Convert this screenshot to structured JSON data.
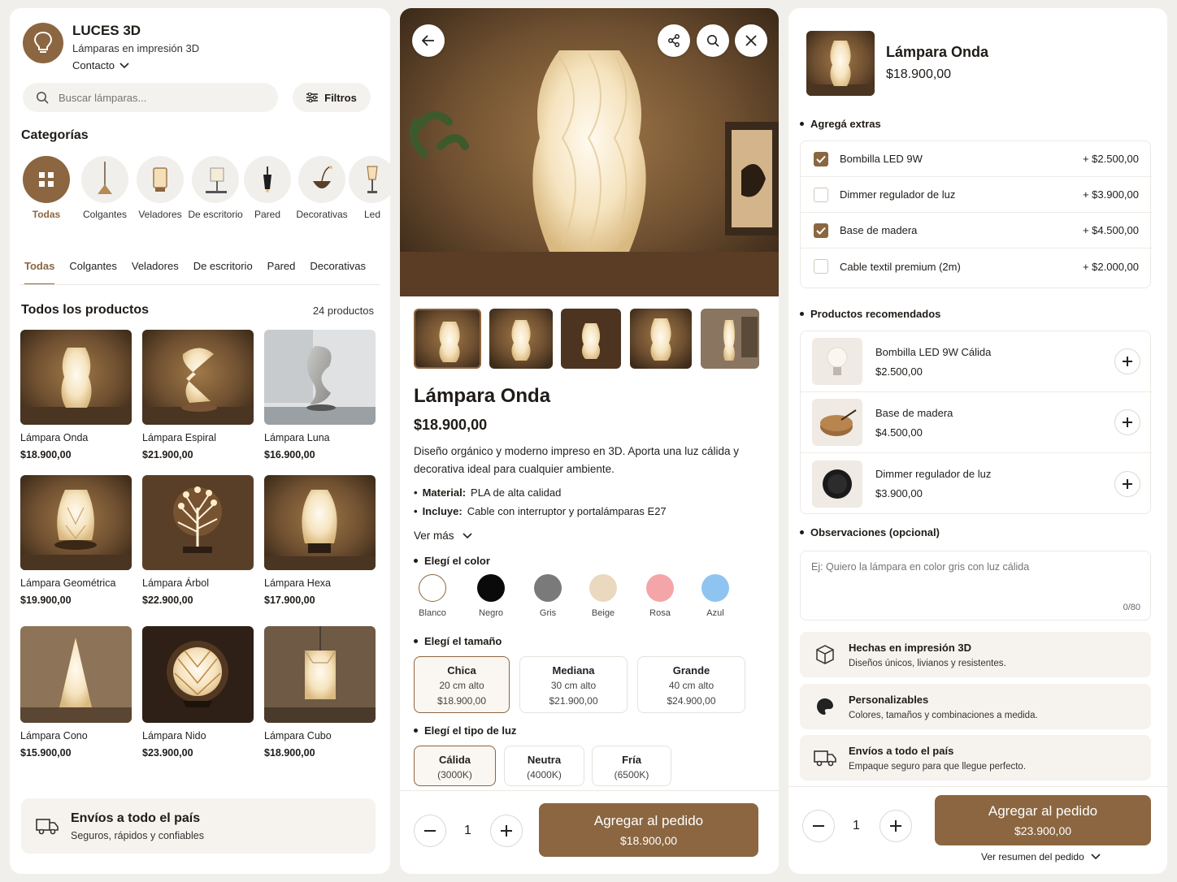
{
  "colors": {
    "accent": "#8b6640",
    "panel": "#ffffff",
    "bg": "#f1efeb"
  },
  "store": {
    "name": "LUCES 3D",
    "tagline": "Lámparas en impresión 3D",
    "contact": "Contacto"
  },
  "search": {
    "placeholder": "Buscar lámparas...",
    "filters_label": "Filtros"
  },
  "categories_title": "Categorías",
  "categories": [
    {
      "label": "Todas",
      "icon": "grid-icon"
    },
    {
      "label": "Colgantes",
      "icon": "pendant-lamp-icon"
    },
    {
      "label": "Veladores",
      "icon": "bedside-lamp-icon"
    },
    {
      "label": "De escritorio",
      "icon": "desk-lamp-icon"
    },
    {
      "label": "Pared",
      "icon": "wall-lamp-icon"
    },
    {
      "label": "Decorativas",
      "icon": "decorative-lamp-icon"
    },
    {
      "label": "Led",
      "icon": "led-lamp-icon"
    }
  ],
  "tabs": [
    "Todas",
    "Colgantes",
    "Veladores",
    "De escritorio",
    "Pared",
    "Decorativas"
  ],
  "products_title": "Todos los productos",
  "products_count": "24 productos",
  "products": [
    {
      "name": "Lámpara Onda",
      "price": "$18.900,00"
    },
    {
      "name": "Lámpara Espiral",
      "price": "$21.900,00"
    },
    {
      "name": "Lámpara Luna",
      "price": "$16.900,00"
    },
    {
      "name": "Lámpara Geométrica",
      "price": "$19.900,00"
    },
    {
      "name": "Lámpara Árbol",
      "price": "$22.900,00"
    },
    {
      "name": "Lámpara Hexa",
      "price": "$17.900,00"
    },
    {
      "name": "Lámpara Cono",
      "price": "$15.900,00"
    },
    {
      "name": "Lámpara Nido",
      "price": "$23.900,00"
    },
    {
      "name": "Lámpara Cubo",
      "price": "$18.900,00"
    }
  ],
  "shipping_banner": {
    "title": "Envíos a todo el país",
    "subtitle": "Seguros, rápidos y confiables"
  },
  "detail": {
    "title": "Lámpara Onda",
    "price": "$18.900,00",
    "description": "Diseño orgánico y moderno impreso en 3D. Aporta una luz cálida y decorativa ideal para cualquier ambiente.",
    "material_label": "Material:",
    "material_value": "PLA de alta calidad",
    "includes_label": "Incluye:",
    "includes_value": "Cable con interruptor y portalámparas E27",
    "see_more": "Ver más",
    "color_title": "Elegí el color",
    "colors": [
      {
        "label": "Blanco",
        "hex": "#ffffff"
      },
      {
        "label": "Negro",
        "hex": "#0a0a0a"
      },
      {
        "label": "Gris",
        "hex": "#7a7a7a"
      },
      {
        "label": "Beige",
        "hex": "#ead8bf"
      },
      {
        "label": "Rosa",
        "hex": "#f4a5a8"
      },
      {
        "label": "Azul",
        "hex": "#8ec4ef"
      }
    ],
    "size_title": "Elegí el tamaño",
    "sizes": [
      {
        "name": "Chica",
        "height": "20 cm alto",
        "price": "$18.900,00"
      },
      {
        "name": "Mediana",
        "height": "30 cm alto",
        "price": "$21.900,00"
      },
      {
        "name": "Grande",
        "height": "40 cm alto",
        "price": "$24.900,00"
      }
    ],
    "light_title": "Elegí el tipo de luz",
    "lights": [
      {
        "name": "Cálida",
        "temp": "(3000K)"
      },
      {
        "name": "Neutra",
        "temp": "(4000K)"
      },
      {
        "name": "Fría",
        "temp": "(6500K)"
      }
    ],
    "quantity": "1",
    "cta_label": "Agregar al pedido",
    "cta_price": "$18.900,00"
  },
  "cart": {
    "title": "Lámpara Onda",
    "price": "$18.900,00",
    "extras_title": "Agregá extras",
    "extras": [
      {
        "label": "Bombilla LED 9W",
        "price": "+ $2.500,00",
        "checked": true
      },
      {
        "label": "Dimmer regulador de luz",
        "price": "+ $3.900,00",
        "checked": false
      },
      {
        "label": "Base de madera",
        "price": "+ $4.500,00",
        "checked": true
      },
      {
        "label": "Cable textil premium (2m)",
        "price": "+ $2.000,00",
        "checked": false
      }
    ],
    "recommended_title": "Productos recomendados",
    "recommended": [
      {
        "name": "Bombilla LED 9W Cálida",
        "price": "$2.500,00"
      },
      {
        "name": "Base de madera",
        "price": "$4.500,00"
      },
      {
        "name": "Dimmer regulador de luz",
        "price": "$3.900,00"
      }
    ],
    "notes_title": "Observaciones (opcional)",
    "notes_placeholder": "Ej: Quiero la lámpara en color gris con luz cálida",
    "notes_counter": "0/80",
    "features": [
      {
        "title": "Hechas en impresión 3D",
        "desc": "Diseños únicos, livianos y resistentes.",
        "icon": "cube-icon"
      },
      {
        "title": "Personalizables",
        "desc": "Colores, tamaños y combinaciones a medida.",
        "icon": "palette-icon"
      },
      {
        "title": "Envíos a todo el país",
        "desc": "Empaque seguro para que llegue perfecto.",
        "icon": "truck-icon"
      }
    ],
    "quantity": "1",
    "cta_label": "Agregar al pedido",
    "cta_price": "$23.900,00",
    "summary_link": "Ver resumen del pedido"
  }
}
